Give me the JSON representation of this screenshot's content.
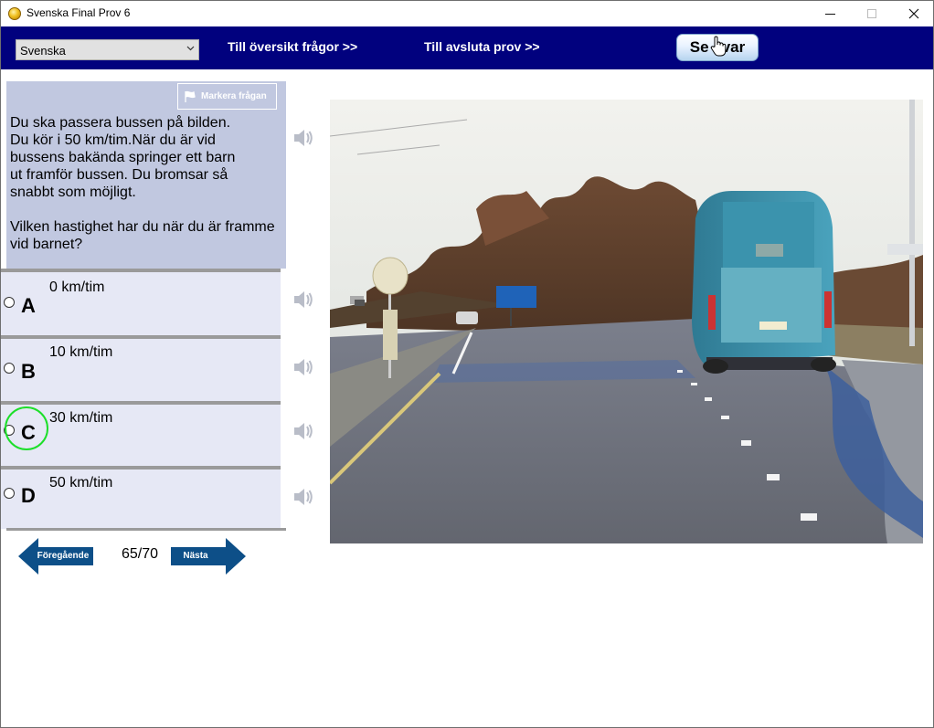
{
  "window": {
    "title": "Svenska Final Prov 6"
  },
  "toolbar": {
    "language": "Svenska",
    "overview_link": "Till översikt frågor >>",
    "finish_link": "Till avsluta prov  >>",
    "answer_button": "Se svar"
  },
  "question": {
    "mark_label": "Markera frågan",
    "text": "Du ska passera bussen på bilden.\nDu kör i 50 km/tim.När du är vid\nbussens bakända springer ett barn\nut framför bussen. Du bromsar så\nsnabbt som möjligt.\n\nVilken hastighet har du när du är framme\nvid barnet?"
  },
  "options": [
    {
      "letter": "A",
      "text": "0 km/tim"
    },
    {
      "letter": "B",
      "text": "10 km/tim"
    },
    {
      "letter": "C",
      "text": "30 km/tim"
    },
    {
      "letter": "D",
      "text": "50 km/tim"
    }
  ],
  "navigation": {
    "prev_label": "Föregående",
    "next_label": "Nästa",
    "counter": "65/70"
  },
  "icons": {
    "app": "coin-icon",
    "speaker": "speaker-icon",
    "flag": "flag-icon",
    "cursor": "hand-cursor-icon"
  },
  "colors": {
    "toolbar_bg": "#01017e",
    "question_bg": "#c1c8e0",
    "option_bg": "#e6e8f5",
    "nav_arrow": "#0d4f88",
    "highlight": "#1ddf2a"
  }
}
